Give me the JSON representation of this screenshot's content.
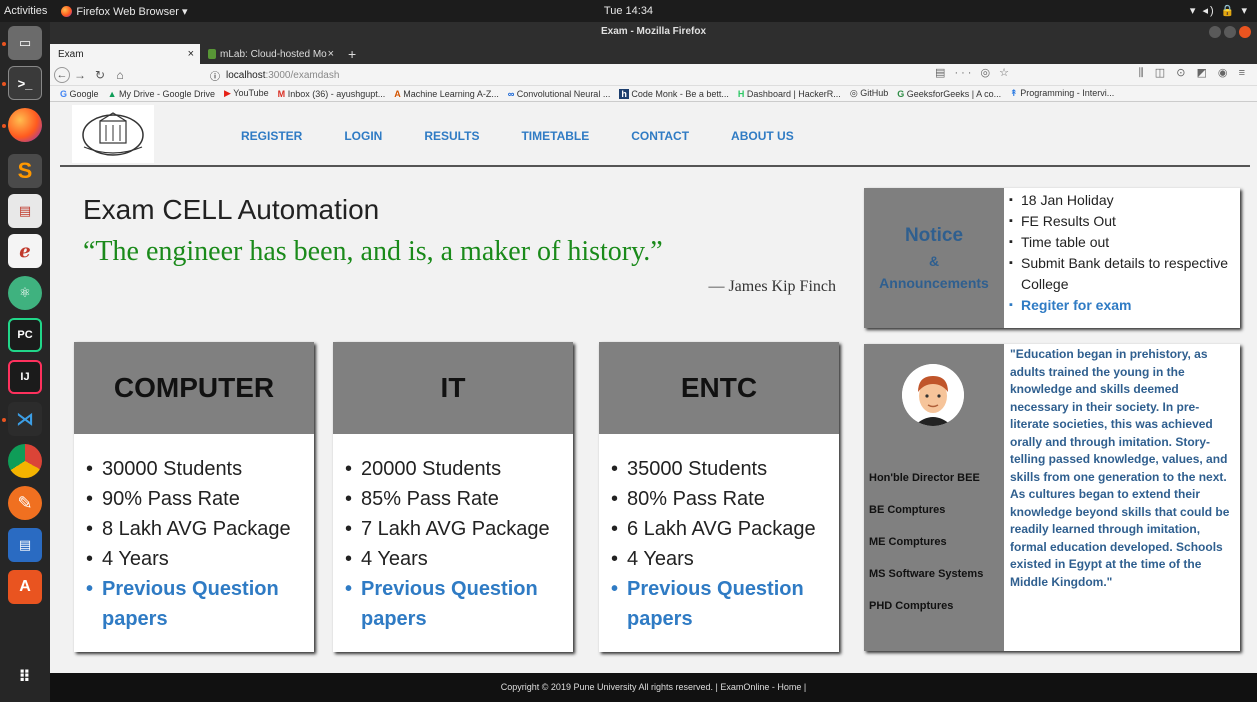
{
  "system": {
    "activities": "Activities",
    "app_name": "Firefox Web Browser ▾",
    "clock": "Tue 14:34",
    "tray": "▾ ◂) 🔒 ▾"
  },
  "dock": {
    "items": [
      "sublime",
      "files",
      "gnome-terminal",
      "atom",
      "pycharm",
      "intellij",
      "vscode",
      "chrome",
      "pencil",
      "writer",
      "store"
    ]
  },
  "window": {
    "title": "Exam - Mozilla Firefox"
  },
  "tabs": [
    {
      "label": "Exam"
    },
    {
      "label": "mLab: Cloud-hosted Mo"
    }
  ],
  "newtab_label": "+",
  "address": {
    "info": "ⓘ",
    "host": "localhost",
    "path": ":3000/examdash",
    "right_icons": "▤  ··· ◎ ☆",
    "toolbar_icons": "⫼ ◫ ⊙ ◩ ◉ ≡"
  },
  "bookmarks": [
    {
      "icon": "G",
      "label": "Google"
    },
    {
      "icon": "▲",
      "label": "My Drive - Google Drive"
    },
    {
      "icon": "▶",
      "label": "YouTube"
    },
    {
      "icon": "M",
      "label": "Inbox (36) - ayushgupt..."
    },
    {
      "icon": "A",
      "label": "Machine Learning A-Z..."
    },
    {
      "icon": "∞",
      "label": "Convolutional Neural ..."
    },
    {
      "icon": "h",
      "label": "Code Monk - Be a bett..."
    },
    {
      "icon": "H",
      "label": "Dashboard | HackerR..."
    },
    {
      "icon": "◎",
      "label": "GitHub"
    },
    {
      "icon": "G",
      "label": "GeeksforGeeks | A co..."
    },
    {
      "icon": "↟",
      "label": "Programming - Intervi..."
    }
  ],
  "site": {
    "nav": [
      "REGISTER",
      "LOGIN",
      "RESULTS",
      "TIMETABLE",
      "CONTACT",
      "ABOUT US"
    ],
    "hero_title": "Exam CELL Automation",
    "hero_quote": "“The engineer has been, and is, a maker of history.”",
    "hero_author": "— James Kip Finch",
    "notice": {
      "title": "Notice",
      "amp": "&",
      "subtitle": "Announcements",
      "items": [
        "18 Jan Holiday",
        "FE Results Out",
        "Time table out",
        "Submit Bank details to respective College"
      ],
      "link": "Regiter for exam"
    },
    "departments": [
      {
        "name": "COMPUTER",
        "stats": [
          "30000 Students",
          "90% Pass Rate",
          "8 Lakh AVG Package",
          "4 Years"
        ],
        "link": "Previous Question papers"
      },
      {
        "name": "IT",
        "stats": [
          "20000 Students",
          "85% Pass Rate",
          "7 Lakh AVG Package",
          "4 Years"
        ],
        "link": "Previous Question papers"
      },
      {
        "name": "ENTC",
        "stats": [
          "35000 Students",
          "80% Pass Rate",
          "6 Lakh AVG Package",
          "4 Years"
        ],
        "link": "Previous Question papers"
      }
    ],
    "director": {
      "links": [
        "Hon'ble Director BEE",
        "BE Comptures",
        "ME Comptures",
        "MS Software Systems",
        "PHD Comptures"
      ],
      "text": "\"Education began in prehistory, as adults trained the young in the knowledge and skills deemed necessary in their society. In pre-literate societies, this was achieved orally and through imitation. Story-telling passed knowledge, values, and skills from one generation to the next. As cultures began to extend their knowledge beyond skills that could be readily learned through imitation, formal education developed. Schools existed in Egypt at the time of the Middle Kingdom.\""
    },
    "footer": "Copyright © 2019 Pune University All rights reserved. | ExamOnline - Home |"
  }
}
